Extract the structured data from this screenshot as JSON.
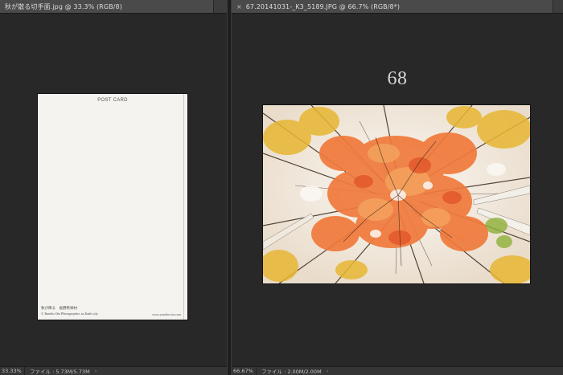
{
  "left_document": {
    "tab_close": "×",
    "tab_title": "秋が散る切手面.jpg @ 33.3% (RGB/8)",
    "zoom": "33.33%",
    "file_info": "ファイル : 5.73M/5.73M",
    "status_arrow": "›",
    "postcard": {
      "heading": "POST CARD",
      "caption_title": "秋が降る　長野県栄村",
      "caption_credit": "© Yumiko Ota Photographer, in Zushi city",
      "url": "www.yumiko-ota.com"
    }
  },
  "right_document": {
    "tab_close": "×",
    "tab_title": "67.20141031-_K3_5189.JPG @ 66.7% (RGB/8*)",
    "page_number": "68",
    "zoom": "66.67%",
    "file_info": "ファイル : 2.00M/2.00M",
    "status_arrow": "›"
  },
  "colors": {
    "app_background": "#282828",
    "tab_active": "#4a4a4a",
    "leaf_orange": "#f07a3c",
    "leaf_yellow": "#e7b632",
    "sky": "#f4efe8"
  }
}
